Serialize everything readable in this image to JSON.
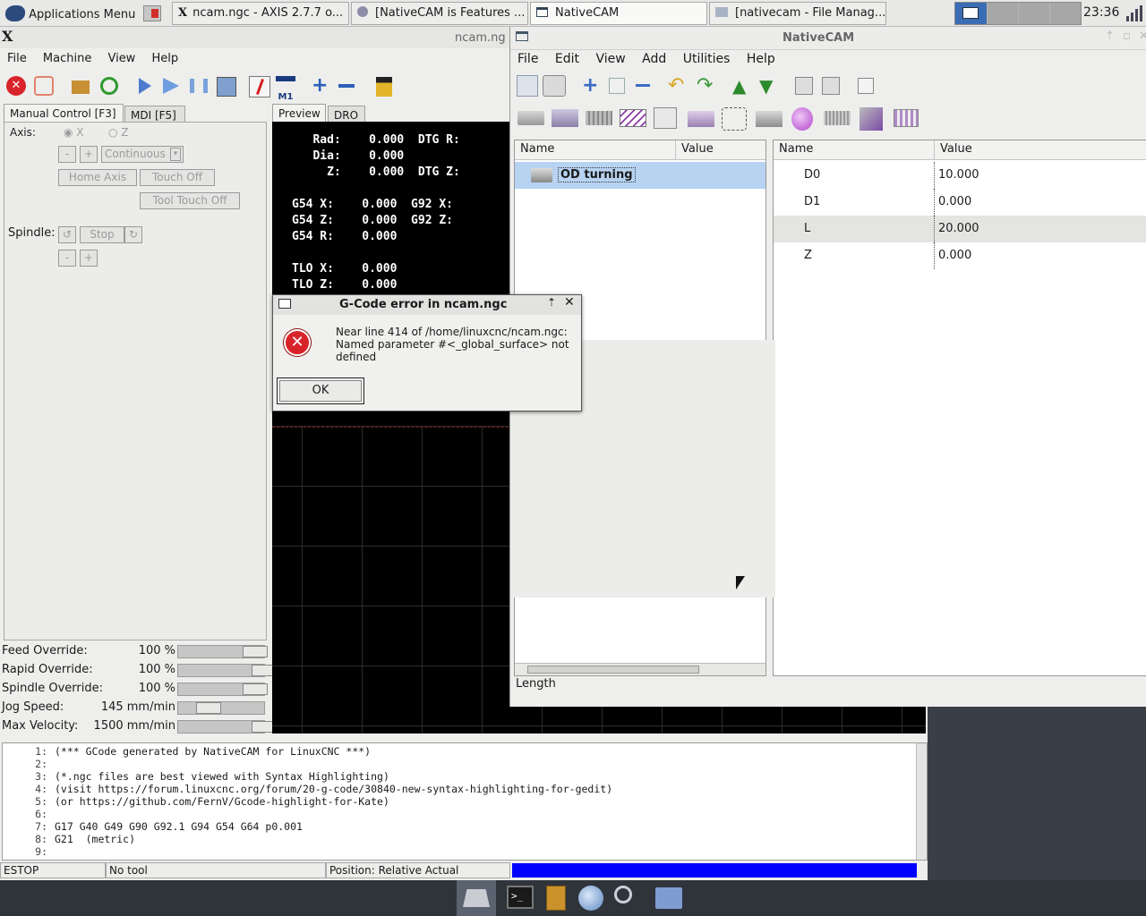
{
  "taskbar": {
    "apps_menu": "Applications Menu",
    "tasks": [
      {
        "label": "ncam.ngc - AXIS 2.7.7 o...",
        "icon": "x-logo-icon"
      },
      {
        "label": "[NativeCAM is Features ...",
        "icon": "browser-icon"
      },
      {
        "label": "NativeCAM",
        "icon": "window-icon"
      },
      {
        "label": "[nativecam - File Manag...",
        "icon": "folder-icon"
      }
    ],
    "clock": "23:36"
  },
  "axis": {
    "title": "ncam.ng",
    "menu": [
      "File",
      "Machine",
      "View",
      "Help"
    ],
    "tabs_left": [
      "Manual Control [F3]",
      "MDI [F5]"
    ],
    "axis_label": "Axis:",
    "axis_options": [
      "X",
      "Z"
    ],
    "jog_minus": "-",
    "jog_plus": "+",
    "jog_mode": "Continuous",
    "home_axis": "Home Axis",
    "touch_off": "Touch Off",
    "tool_touch_off": "Tool Touch Off",
    "spindle_label": "Spindle:",
    "spindle_stop": "Stop",
    "spindle_minus": "-",
    "spindle_plus": "+",
    "overrides": [
      {
        "label": "Feed Override:",
        "value": "100 %",
        "pct": 0.88
      },
      {
        "label": "Rapid Override:",
        "value": "100 %",
        "pct": 0.98
      },
      {
        "label": "Spindle Override:",
        "value": "100 %",
        "pct": 0.88
      },
      {
        "label": "Jog Speed:",
        "value": "145 mm/min",
        "pct": 0.35
      },
      {
        "label": "Max Velocity:",
        "value": "1500 mm/min",
        "pct": 0.98
      }
    ],
    "tabs_right": [
      "Preview",
      "DRO"
    ],
    "dro_lines": [
      "   Rad:    0.000  DTG R:",
      "   Dia:    0.000",
      "     Z:    0.000  DTG Z:",
      "",
      "G54 X:    0.000  G92 X:",
      "G54 Z:    0.000  G92 Z:",
      "G54 R:    0.000",
      "",
      "TLO X:    0.000",
      "TLO Z:    0.000"
    ],
    "gcode": [
      {
        "n": "1:",
        "t": "(*** GCode generated by NativeCAM for LinuxCNC ***)"
      },
      {
        "n": "2:",
        "t": ""
      },
      {
        "n": "3:",
        "t": "(*.ngc files are best viewed with Syntax Highlighting)"
      },
      {
        "n": "4:",
        "t": "(visit https://forum.linuxcnc.org/forum/20-g-code/30840-new-syntax-highlighting-for-gedit)"
      },
      {
        "n": "5:",
        "t": "(or https://github.com/FernV/Gcode-highlight-for-Kate)"
      },
      {
        "n": "6:",
        "t": ""
      },
      {
        "n": "7:",
        "t": "G17 G40 G49 G90 G92.1 G94 G54 G64 p0.001"
      },
      {
        "n": "8:",
        "t": "G21  (metric)"
      },
      {
        "n": "9:",
        "t": ""
      }
    ],
    "status": [
      "ESTOP",
      "No tool",
      "Position: Relative Actual"
    ]
  },
  "nativecam": {
    "title": "NativeCAM",
    "menu": [
      "File",
      "Edit",
      "View",
      "Add",
      "Utilities",
      "Help"
    ],
    "tree_headers": [
      "Name",
      "Value"
    ],
    "tree_item": "OD turning",
    "param_headers": [
      "Name",
      "Value"
    ],
    "params": [
      {
        "name": "D0",
        "value": "10.000"
      },
      {
        "name": "D1",
        "value": "0.000"
      },
      {
        "name": "L",
        "value": "20.000"
      },
      {
        "name": "Z",
        "value": "0.000"
      }
    ],
    "status_text": "Length"
  },
  "dialog": {
    "title": "G-Code error in ncam.ngc",
    "message_1": "Near line 414 of /home/linuxcnc/ncam.ngc:",
    "message_2": "Named parameter #<_global_surface> not",
    "message_3": "defined",
    "ok": "OK"
  },
  "colors": {
    "accent_blue": "#0000ff",
    "error_red": "#d8232a",
    "selection": "#b8d3f2"
  }
}
